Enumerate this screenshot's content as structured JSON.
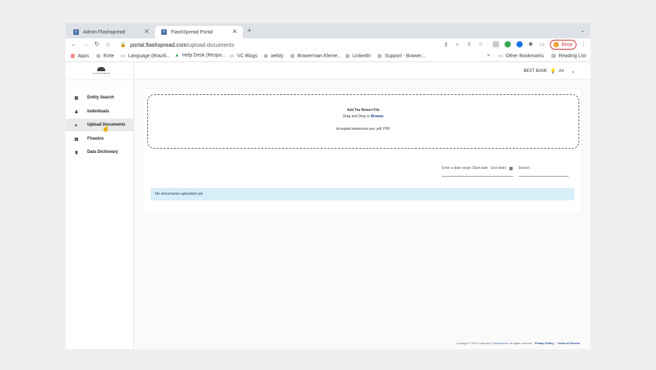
{
  "browser": {
    "tabs": [
      {
        "label": "Admin Flashspread"
      },
      {
        "label": "FlashSpread Portal"
      }
    ],
    "url_host": "portal.flashspread.com",
    "url_path": "/upload-documents",
    "error_label": "Error",
    "bookmarks": [
      "Apps",
      "Evite",
      "Language (Brazili...",
      "Help Desk (Respo...",
      "VC Blogs",
      "webly",
      "Brawerman Eleme...",
      "LinkedIn",
      "Support - Brawer..."
    ],
    "other_bookmarks": "Other Bookmarks",
    "reading_list": "Reading List"
  },
  "sidebar": {
    "logo_text": "FLASHSPREAD",
    "items": [
      {
        "label": "Entity Search",
        "icon": "building-icon"
      },
      {
        "label": "Individuals",
        "icon": "person-icon"
      },
      {
        "label": "Upload Documents",
        "icon": "upload-icon"
      },
      {
        "label": "Finastra",
        "icon": "document-icon"
      },
      {
        "label": "Data Dictionary",
        "icon": "book-icon"
      }
    ]
  },
  "header": {
    "company": "BEST BANK",
    "user": "Ari"
  },
  "upload": {
    "title": "Add Tax Return File",
    "instructions": "Drag and Drop or",
    "browse": "Browse",
    "extensions": "Accepted extensions are: pdf, PDF"
  },
  "filters": {
    "date_placeholder": "Enter a date range (Start date - End date)",
    "search_placeholder": "Search"
  },
  "empty_message": "No documents uploaded yet",
  "footer": {
    "copyright": "Copyright © 2021 Company:",
    "brand": "FlashSpread.",
    "rights": "All rights reserved.",
    "privacy": "Privacy Policy",
    "terms": "Terms of Service"
  },
  "colors": {
    "accent": "#1a3d8a",
    "info_bg": "#d8eef8"
  }
}
